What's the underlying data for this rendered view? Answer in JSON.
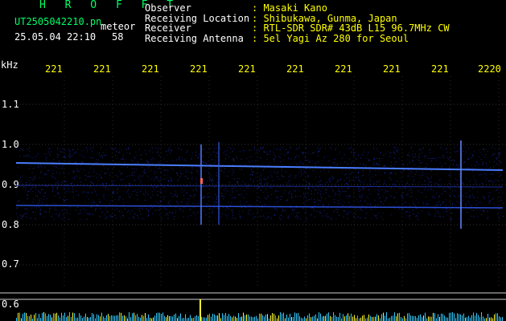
{
  "header": {
    "title": "H R O F F T",
    "filename": "UT2505042210.pn",
    "tag": "meteor",
    "datetime": "25.05.04 22:10",
    "count": "58"
  },
  "info": {
    "labels": [
      "Observer",
      "Receiving Location",
      "Receiver",
      "Receiving Antenna"
    ],
    "values": [
      ": Masaki Kano",
      ": Shibukawa, Gunma, Japan",
      ": RTL-SDR SDR# 43dB L15 96.7MHz CW",
      ": 5el Yagi Az 280 for Seoul"
    ]
  },
  "axes": {
    "y_unit": "kHz",
    "y_labels": [
      "1.1",
      "1.0",
      "0.9",
      "0.8",
      "0.7",
      "0.6"
    ],
    "x_labels": [
      "221",
      "221",
      "221",
      "221",
      "221",
      "221",
      "221",
      "221",
      "221",
      "2220"
    ]
  },
  "colors": {
    "text_green": "#00ff66",
    "text_white": "#ffffff",
    "text_yellow": "#ffff00",
    "signal_blue": "#3366ff",
    "signal_bright": "#66ccff"
  }
}
